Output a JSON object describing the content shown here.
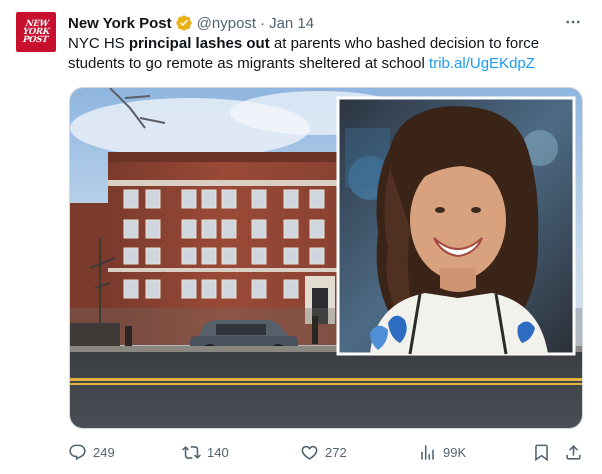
{
  "account": {
    "avatar_text": [
      "NEW",
      "YORK",
      "POST"
    ],
    "display_name": "New York Post",
    "verified": "gold-verified-badge",
    "handle": "@nypost",
    "separator": "·",
    "date": "Jan 14"
  },
  "tweet": {
    "text_parts": [
      {
        "text": "NYC HS ",
        "style": "normal"
      },
      {
        "text": "principal lashes out",
        "style": "bold"
      },
      {
        "text": " at parents who bashed decision to force students to go remote as migrants sheltered at school ",
        "style": "normal"
      },
      {
        "text": "trib.al/UgEKdpZ",
        "style": "link"
      }
    ]
  },
  "media": {
    "main_photo": "brick-school-building-street-scene",
    "inset_photo": "smiling-woman-curly-hair-portrait"
  },
  "actions": {
    "replies": "249",
    "reposts": "140",
    "likes": "272",
    "views": "99K"
  },
  "icons": {
    "more": "more-icon",
    "reply": "reply-icon",
    "repost": "repost-icon",
    "like": "like-icon",
    "views": "views-icon",
    "bookmark": "bookmark-icon",
    "share": "share-icon"
  },
  "colors": {
    "brand_red": "#c8102e",
    "link": "#1d9bf0",
    "muted": "#536471",
    "verified_gold": "#e8b114"
  }
}
